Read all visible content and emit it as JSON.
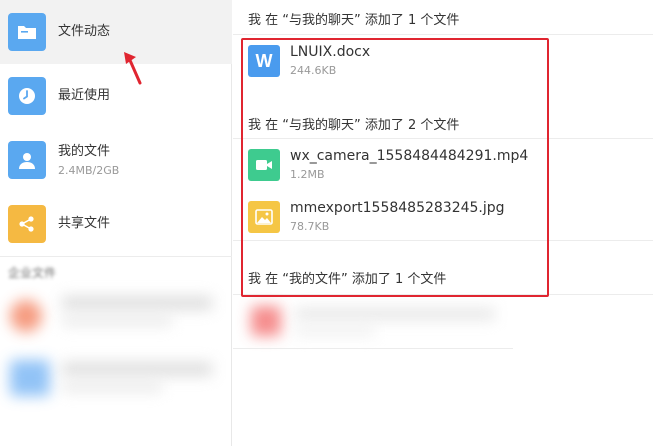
{
  "sidebar": {
    "items": [
      {
        "label": "文件动态",
        "sub": "",
        "icon": "folder-icon",
        "color": "#5aa8f0"
      },
      {
        "label": "最近使用",
        "sub": "",
        "icon": "clock-icon",
        "color": "#5aa8f0"
      },
      {
        "label": "我的文件",
        "sub": "2.4MB/2GB",
        "icon": "user-icon",
        "color": "#5aa8f0"
      },
      {
        "label": "共享文件",
        "sub": "",
        "icon": "share-icon",
        "color": "#f5b942"
      }
    ],
    "section_label": "企业文件"
  },
  "activity": {
    "line1": "我 在 “与我的聊天” 添加了 1 个文件",
    "line2": "我 在 “与我的聊天” 添加了 2 个文件",
    "line3": "我 在 “我的文件” 添加了 1 个文件"
  },
  "files": [
    {
      "name": "LNUIX.docx",
      "size": "244.6KB",
      "icon": "word-doc-icon",
      "color": "#4a9bee",
      "glyph": "W"
    },
    {
      "name": "wx_camera_1558484484291.mp4",
      "size": "1.2MB",
      "icon": "video-icon",
      "color": "#3ecb8f",
      "glyph": ""
    },
    {
      "name": "mmexport1558485283245.jpg",
      "size": "78.7KB",
      "icon": "image-icon",
      "color": "#f5c645",
      "glyph": ""
    }
  ],
  "colors": {
    "accent_blue": "#5aa8f0",
    "highlight_red": "#e02530",
    "arrow_red": "#e02530"
  }
}
